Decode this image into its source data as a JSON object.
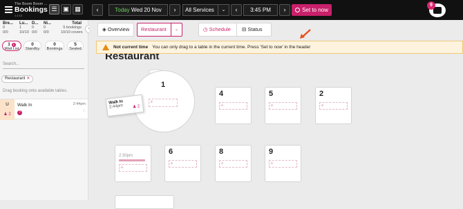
{
  "header": {
    "venue": "The Boom Boom ...",
    "title": "Bookings",
    "version": "1.4.15",
    "date_today": "Today",
    "date_text": "Wed 20 Nov",
    "service": "All Services",
    "time": "3:45 PM",
    "set_now_label": "Set to now",
    "notification_count": "9",
    "prev_day": "‹",
    "next_day": "›",
    "prev_time": "‹",
    "next_time": "›",
    "chevron": "⌄"
  },
  "stats": {
    "columns": [
      {
        "head": "Bre...",
        "v1": "0",
        "v2": "0/0"
      },
      {
        "head": "Lu...",
        "v1": "1",
        "v2": "10/10"
      },
      {
        "head": "D...",
        "v1": "0",
        "v2": "0/0"
      },
      {
        "head": "Ni...",
        "v1": "0",
        "v2": "0/0"
      },
      {
        "head": "Total",
        "v1": "5 bookings",
        "v2": "10/10 covers"
      }
    ]
  },
  "pills": [
    {
      "count": "1",
      "badge": "1",
      "label": "Wait List"
    },
    {
      "count": "0",
      "label": "Standby"
    },
    {
      "count": "0",
      "label": "Bookings"
    },
    {
      "count": "5",
      "label": "Seated"
    }
  ],
  "sidebar": {
    "search_placeholder": "Search...",
    "filter_chip": "Restaurant",
    "chip_close": "✕",
    "hint": "Drag booking onto available tables.",
    "walkin": {
      "status": "U",
      "covers": "2",
      "name": "Walk In",
      "time": "2:44pm",
      "question": "?",
      "pin": "⫶"
    },
    "collapse": "‹"
  },
  "toolbar": {
    "overview": "Overview",
    "restaurant": "Restaurant",
    "schedule": "Schedule",
    "status": "Status"
  },
  "banner": {
    "title": "Not current time",
    "message": "You can only drag to a table in the current time. Press 'Set to now' in the header"
  },
  "floor": {
    "area_title": "Restaurant",
    "tables": [
      "1",
      "4",
      "5",
      "2",
      "6",
      "8",
      "9"
    ],
    "walkin_card": {
      "name": "Walk In",
      "time": "2:44pm",
      "covers": "2"
    },
    "table2_time": "2:30pm",
    "plus": "+"
  },
  "colors": {
    "accent": "#c8206a",
    "warning": "#e88a15",
    "banner_bg": "#fdf3de"
  }
}
